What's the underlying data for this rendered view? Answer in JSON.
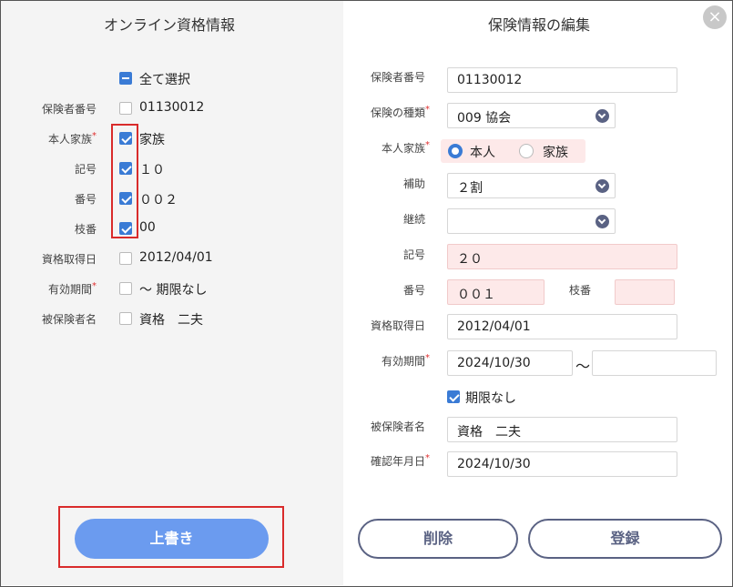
{
  "left": {
    "title": "オンライン資格情報",
    "select_all": "全て選択",
    "rows": [
      {
        "label": "保険者番号",
        "value": "01130012",
        "required": false
      },
      {
        "label": "本人家族",
        "value": "家族",
        "required": true
      },
      {
        "label": "記号",
        "value": "１０",
        "required": false
      },
      {
        "label": "番号",
        "value": "００２",
        "required": false
      },
      {
        "label": "枝番",
        "value": "00",
        "required": false
      },
      {
        "label": "資格取得日",
        "value": "2012/04/01",
        "required": false
      },
      {
        "label": "有効期間",
        "value": "～ 期限なし",
        "required": true
      },
      {
        "label": "被保険者名",
        "value": "資格　二夫",
        "required": false
      }
    ],
    "overwrite_button": "上書き"
  },
  "right": {
    "title": "保険情報の編集",
    "close_icon": "×",
    "insurer_number": {
      "label": "保険者番号",
      "value": "01130012"
    },
    "insurance_type": {
      "label": "保険の種類",
      "value": "009 協会"
    },
    "person_family": {
      "label": "本人家族",
      "option_self": "本人",
      "option_family": "家族"
    },
    "assist": {
      "label": "補助",
      "value": "２割"
    },
    "continuation": {
      "label": "継続",
      "value": ""
    },
    "symbol": {
      "label": "記号",
      "value": "２０"
    },
    "number": {
      "label": "番号",
      "value": "００１"
    },
    "branch": {
      "label": "枝番",
      "value": ""
    },
    "acquired_date": {
      "label": "資格取得日",
      "value": "2012/04/01"
    },
    "valid_period": {
      "label": "有効期間",
      "from": "2024/10/30",
      "tilde": "～",
      "to": ""
    },
    "no_limit": "期限なし",
    "insured_name": {
      "label": "被保険者名",
      "value": "資格　二夫"
    },
    "confirm_date": {
      "label": "確認年月日",
      "value": "2024/10/30"
    },
    "delete_button": "削除",
    "register_button": "登録"
  },
  "colors": {
    "accent": "#3a7bd5",
    "button_blue": "#6b9bef",
    "navy": "#5a6283",
    "pink": "#fde9e9",
    "highlight_red": "#d92b2b"
  }
}
